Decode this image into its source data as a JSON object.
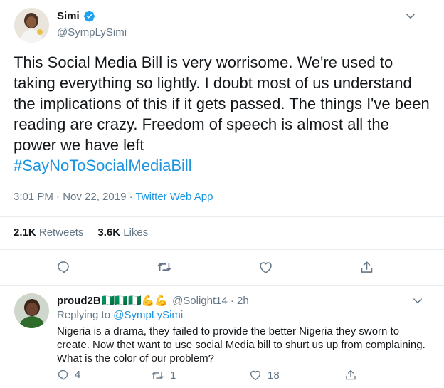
{
  "tweet": {
    "author_name": "Simi",
    "author_handle": "@SympLySimi",
    "text": "This Social Media Bill is very worrisome. We're used to taking everything so lightly. I doubt most of us understand the implications of this if it gets passed. The things I've been reading are crazy. Freedom of speech is almost all the power we have left",
    "hashtag": "#SayNoToSocialMediaBill",
    "time": "3:01 PM · Nov 22, 2019 · ",
    "source": "Twitter Web App",
    "retweets_count": "2.1K",
    "retweets_label": "Retweets",
    "likes_count": "3.6K",
    "likes_label": "Likes"
  },
  "reply": {
    "author_name": "proud2B",
    "emojis": "🇳🇬🇳🇬🇳🇬💪💪",
    "author_handle": "@Solight14",
    "time": "· 2h",
    "replying_to_prefix": "Replying to ",
    "replying_to_handle": "@SympLySimi",
    "text": "Nigeria is a drama, they failed to provide the better Nigeria they sworn to create. Now thet want to use social Media bill to shurt us up from complaining.  What is the color of our problem?",
    "reply_count": "4",
    "retweet_count": "1",
    "like_count": "18"
  },
  "colors": {
    "accent": "#1b95e0",
    "muted": "#657786",
    "border": "#e6ecf0",
    "verified": "#1da1f2"
  }
}
